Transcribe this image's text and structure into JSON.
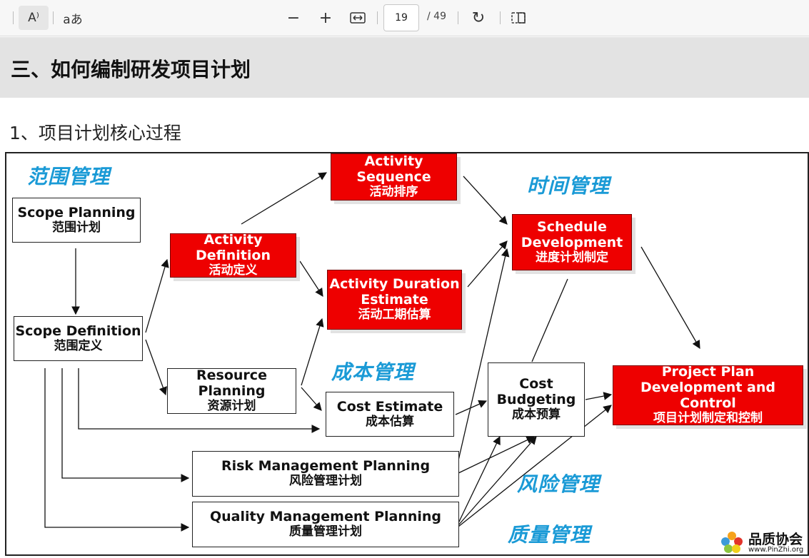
{
  "toolbar": {
    "read_aloud_icon": "A⁾",
    "text_options_icon": "aあ",
    "zoom_out_icon": "−",
    "zoom_in_icon": "+",
    "fit_icon": "⇔",
    "page_current": "19",
    "page_total": "/ 49",
    "rotate_icon": "↻",
    "layout_icon": "▯"
  },
  "page": {
    "title": "三、如何编制研发项目计划",
    "subtitle": "1、项目计划核心过程"
  },
  "diagram": {
    "areas": {
      "scope": "范围管理",
      "time": "时间管理",
      "cost": "成本管理",
      "risk": "风险管理",
      "quality": "质量管理"
    },
    "nodes": {
      "scope_planning": {
        "en": "Scope Planning",
        "zh": "范围计划"
      },
      "scope_definition": {
        "en": "Scope Definition",
        "zh": "范围定义"
      },
      "activity_definition": {
        "en": "Activity Definition",
        "zh": "活动定义"
      },
      "resource_planning": {
        "en": "Resource Planning",
        "zh": "资源计划"
      },
      "activity_sequence": {
        "en": "Activity Sequence",
        "zh": "活动排序"
      },
      "activity_duration": {
        "en1": "Activity Duration",
        "en2": "Estimate",
        "zh": "活动工期估算"
      },
      "schedule_development": {
        "en1": "Schedule",
        "en2": "Development",
        "zh": "进度计划制定"
      },
      "cost_estimate": {
        "en": "Cost Estimate",
        "zh": "成本估算"
      },
      "cost_budgeting": {
        "en1": "Cost",
        "en2": "Budgeting",
        "zh": "成本预算"
      },
      "project_plan": {
        "en1": "Project Plan",
        "en2": "Development and Control",
        "zh": "项目计划制定和控制"
      },
      "risk_planning": {
        "en": "Risk Management  Planning",
        "zh": "风险管理计划"
      },
      "quality_planning": {
        "en": "Quality Management  Planning",
        "zh": "质量管理计划"
      }
    },
    "colors": {
      "red_node": "#ee0000",
      "area_label": "#1a9ad6"
    }
  },
  "logo": {
    "name": "品质协会",
    "url": "www.PinZhi.org"
  }
}
